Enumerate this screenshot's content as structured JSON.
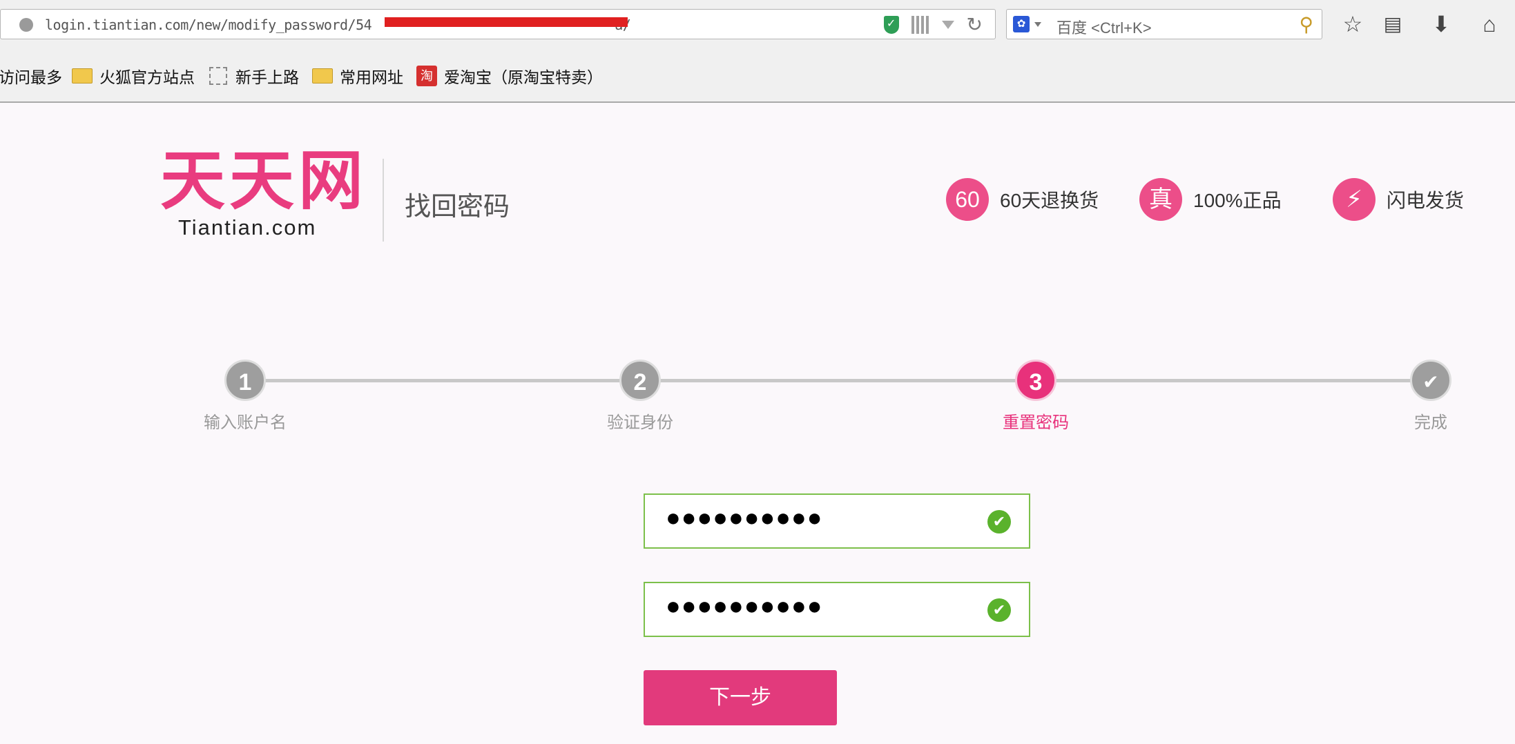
{
  "browser": {
    "url": "login.tiantian.com/new/modify_password/54",
    "url_tail": "a/",
    "search_placeholder": "百度 <Ctrl+K>",
    "reload_glyph": "↻",
    "bookmarks": [
      {
        "label": "访问最多"
      },
      {
        "label": "火狐官方站点"
      },
      {
        "label": "新手上路"
      },
      {
        "label": "常用网址"
      },
      {
        "label": "爱淘宝（原淘宝特卖）",
        "icon_text": "淘"
      }
    ]
  },
  "header": {
    "logo_cn": "天天网",
    "logo_en": "Tiantian.com",
    "page_title": "找回密码",
    "badges": [
      {
        "icon": "60",
        "text": "60天退换货"
      },
      {
        "icon": "真",
        "text": "100%正品"
      },
      {
        "icon": "⚡",
        "text": "闪电发货"
      }
    ]
  },
  "steps": [
    {
      "num": "1",
      "label": "输入账户名",
      "active": false
    },
    {
      "num": "2",
      "label": "验证身份",
      "active": false
    },
    {
      "num": "3",
      "label": "重置密码",
      "active": true
    },
    {
      "num": "✔",
      "label": "完成",
      "active": false
    }
  ],
  "form": {
    "password_mask": "●●●●●●●●●●",
    "confirm_mask": "●●●●●●●●●●",
    "check_glyph": "✔",
    "next_label": "下一步"
  },
  "colors": {
    "brand": "#e93c7f",
    "valid": "#7cc04a"
  }
}
